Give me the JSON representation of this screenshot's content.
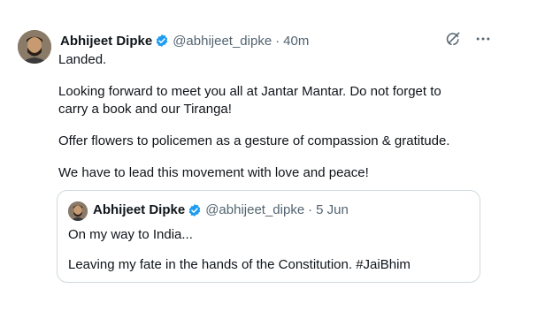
{
  "tweet": {
    "author_name": "Abhijeet Dipke",
    "handle": "@abhijeet_dipke",
    "separator": "·",
    "time": "40m",
    "verified": true,
    "paragraphs": [
      "Landed.",
      "Looking forward to meet you all at Jantar Mantar. Do not forget to carry a book and our Tiranga!",
      "Offer flowers to policemen as a gesture of compassion & gratitude.",
      "We have to lead this movement with love and peace!"
    ]
  },
  "quoted": {
    "author_name": "Abhijeet Dipke",
    "handle": "@abhijeet_dipke",
    "separator": "·",
    "time": "5 Jun",
    "verified": true,
    "lines": [
      "On my way to India...",
      "Leaving my fate in the hands of the Constitution. #JaiBhim"
    ]
  },
  "icons": {
    "verified": "verified-badge-icon",
    "grok": "grok-icon",
    "more": "more-icon"
  },
  "colors": {
    "verified_blue": "#1d9bf0",
    "secondary_text": "#536471",
    "border": "#cfd9de"
  }
}
